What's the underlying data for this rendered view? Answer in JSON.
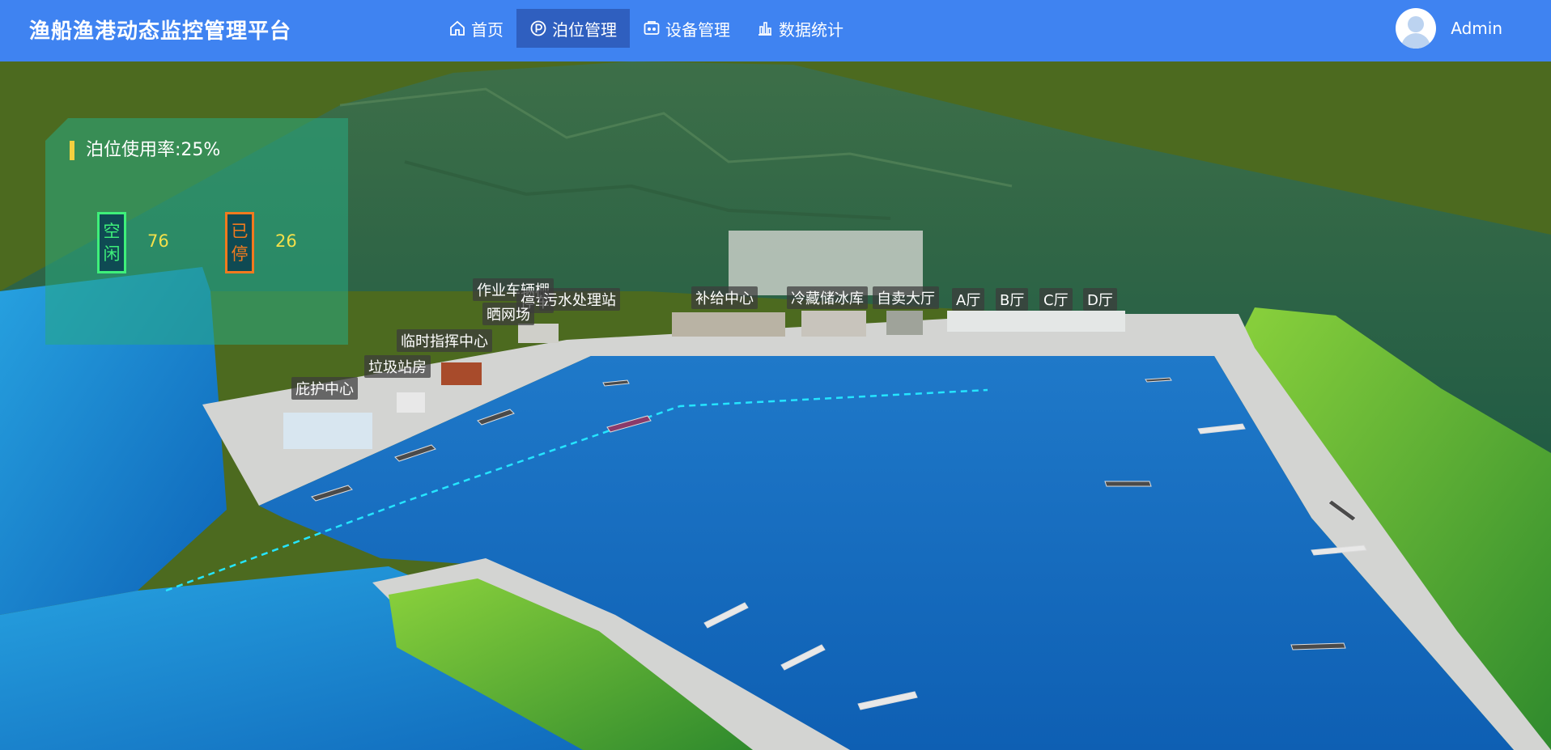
{
  "header": {
    "title": "渔船渔港动态监控管理平台",
    "nav": [
      {
        "label": "首页",
        "icon": "home-icon"
      },
      {
        "label": "泊位管理",
        "icon": "parking-icon",
        "active": true
      },
      {
        "label": "设备管理",
        "icon": "device-icon"
      },
      {
        "label": "数据统计",
        "icon": "bar-chart-icon"
      }
    ],
    "user": {
      "name": "Admin"
    }
  },
  "panel": {
    "title": "泊位使用率:25%",
    "free": {
      "label": [
        "空",
        "闲"
      ],
      "count": "76"
    },
    "used": {
      "label": [
        "已",
        "停"
      ],
      "count": "26"
    }
  },
  "map_labels": [
    {
      "id": "work-shed",
      "text": "作业车辆棚"
    },
    {
      "id": "parking",
      "text": "停车"
    },
    {
      "id": "sewage",
      "text": "污水处理站"
    },
    {
      "id": "net-drying",
      "text": "晒网场"
    },
    {
      "id": "temp-command",
      "text": "临时指挥中心"
    },
    {
      "id": "garbage",
      "text": "垃圾站房"
    },
    {
      "id": "shelter",
      "text": "庇护中心"
    },
    {
      "id": "supply",
      "text": "补给中心"
    },
    {
      "id": "cold-storage",
      "text": "冷藏储冰库"
    },
    {
      "id": "self-sale",
      "text": "自卖大厅"
    },
    {
      "id": "hall-a",
      "text": "A厅"
    },
    {
      "id": "hall-b",
      "text": "B厅"
    },
    {
      "id": "hall-c",
      "text": "C厅"
    },
    {
      "id": "hall-d",
      "text": "D厅"
    }
  ],
  "colors": {
    "header_bg": "#3f83f1",
    "active_nav_bg": "#2f5fbf",
    "panel_bg": "rgba(40,170,130,0.55)",
    "free": "#3ef07a",
    "used": "#f27a1e",
    "count": "#f4e04a",
    "water": "#1a7fd2",
    "route": "#25e5ff"
  }
}
